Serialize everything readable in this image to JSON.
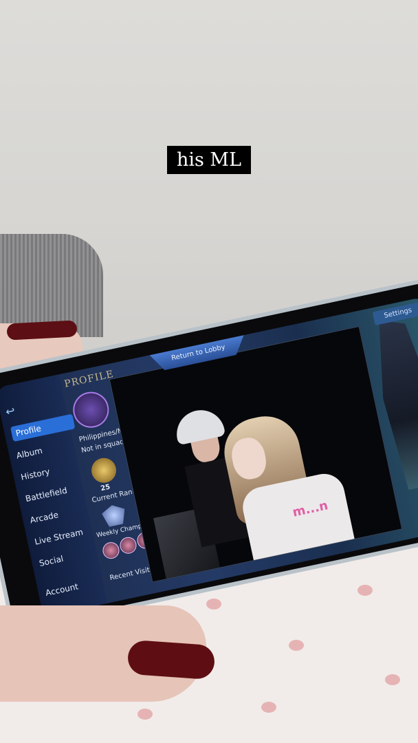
{
  "caption": "his ML",
  "game_ui": {
    "section_title": "PROFILE",
    "return_button": "Return to Lobby",
    "settings_button": "Settings",
    "nav": [
      "Profile",
      "Album",
      "History",
      "Battlefield",
      "Arcade",
      "Live Stream",
      "Social",
      "Account"
    ],
    "region": "Philippines/M",
    "squad_status": "Not in squad",
    "rank_number": "25",
    "rank_label": "Current Rank",
    "weekly_label": "Weekly Champion's",
    "recent_visits_label": "Recent Visits"
  },
  "photo": {
    "shirt_text": "m...n"
  }
}
